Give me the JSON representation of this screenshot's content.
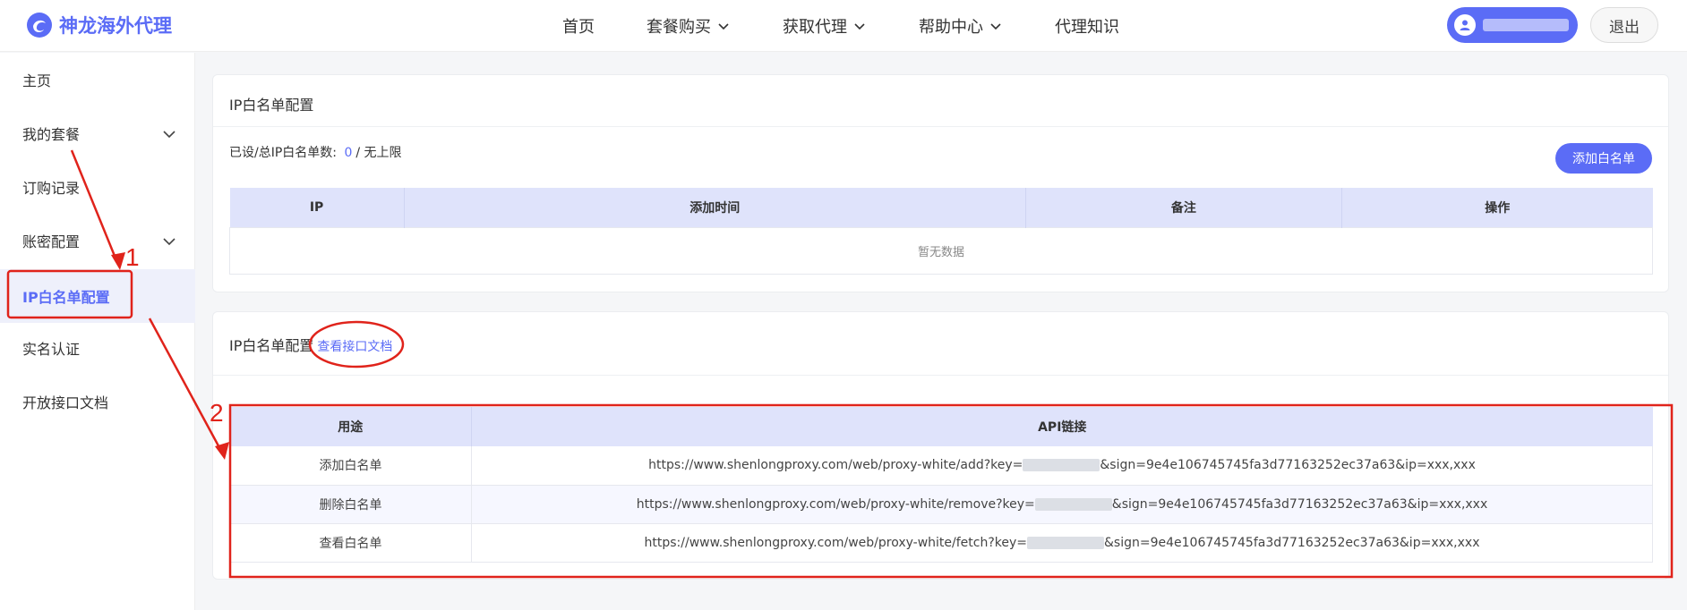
{
  "brand": {
    "name": "神龙海外代理"
  },
  "nav": {
    "items": [
      {
        "label": "首页",
        "dropdown": false
      },
      {
        "label": "套餐购买",
        "dropdown": true
      },
      {
        "label": "获取代理",
        "dropdown": true
      },
      {
        "label": "帮助中心",
        "dropdown": true
      },
      {
        "label": "代理知识",
        "dropdown": false
      }
    ]
  },
  "user": {
    "name": "",
    "logout_label": "退出"
  },
  "sidebar": {
    "items": [
      {
        "label": "主页"
      },
      {
        "label": "我的套餐",
        "expandable": true
      },
      {
        "label": "订购记录"
      },
      {
        "label": "账密配置",
        "expandable": true
      },
      {
        "label": "IP白名单配置",
        "active": true
      },
      {
        "label": "实名认证"
      },
      {
        "label": "开放接口文档"
      }
    ]
  },
  "whitelist": {
    "title": "IP白名单配置",
    "count_label": "已设/总IP白名单数:",
    "count_value": "0",
    "count_suffix": "/ 无上限",
    "add_button": "添加白名单",
    "columns": [
      "IP",
      "添加时间",
      "备注",
      "操作"
    ],
    "empty_text": "暂无数据"
  },
  "api": {
    "title": "IP白名单配置",
    "doc_link": "查看接口文档",
    "columns": [
      "用途",
      "API链接"
    ],
    "rows": [
      {
        "purpose": "添加白名单",
        "url_prefix": "https://www.shenlongproxy.com/web/proxy-white/add?key=",
        "url_suffix": "&sign=9e4e106745745fa3d77163252ec37a63&ip=xxx,xxx"
      },
      {
        "purpose": "删除白名单",
        "url_prefix": "https://www.shenlongproxy.com/web/proxy-white/remove?key=",
        "url_suffix": "&sign=9e4e106745745fa3d77163252ec37a63&ip=xxx,xxx"
      },
      {
        "purpose": "查看白名单",
        "url_prefix": "https://www.shenlongproxy.com/web/proxy-white/fetch?key=",
        "url_suffix": "&sign=9e4e106745745fa3d77163252ec37a63&ip=xxx,xxx"
      }
    ]
  },
  "annotations": {
    "step1": "1",
    "step2": "2",
    "color": "#e0231b"
  },
  "colors": {
    "accent": "#5b6cf6",
    "header_row": "#dfe3fb"
  }
}
